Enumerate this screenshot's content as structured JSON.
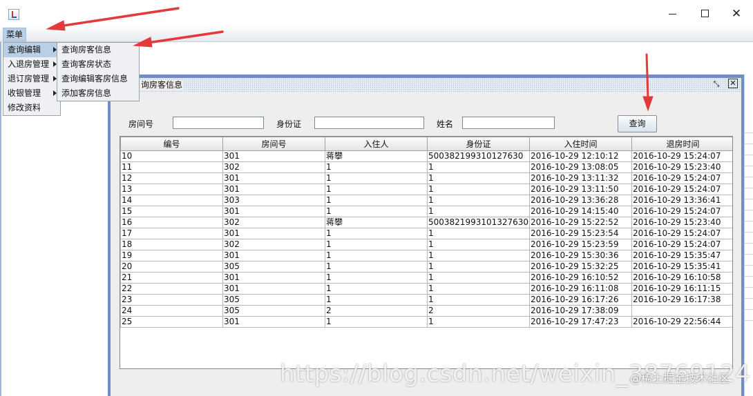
{
  "menubar": {
    "menu_label": "菜单"
  },
  "menu": {
    "items": [
      {
        "label": "查询编辑",
        "has_submenu": true
      },
      {
        "label": "入退房管理",
        "has_submenu": true
      },
      {
        "label": "退订房管理",
        "has_submenu": true
      },
      {
        "label": "收银管理",
        "has_submenu": true
      },
      {
        "label": "修改资料",
        "has_submenu": false
      }
    ],
    "submenu": [
      {
        "label": "查询房客信息"
      },
      {
        "label": "查询客房状态"
      },
      {
        "label": "查询编辑客房信息"
      },
      {
        "label": "添加客房信息"
      }
    ]
  },
  "window": {
    "title": "询房客信息",
    "colors": {
      "accent": "#b8cfe5",
      "frame": "#6f8fc3",
      "arrow": "#e23a3a"
    }
  },
  "search": {
    "room_label": "房间号",
    "room_value": "",
    "id_label": "身份证",
    "id_value": "",
    "name_label": "姓名",
    "name_value": "",
    "query_button": "查询"
  },
  "table": {
    "columns": [
      "编号",
      "房间号",
      "入住人",
      "身份证",
      "入住时间",
      "退房时间"
    ],
    "rows": [
      [
        "10",
        "301",
        "蒋攀",
        "500382199310127630",
        "2016-10-29 12:10:12",
        "2016-10-29 15:24:07"
      ],
      [
        "11",
        "302",
        "1",
        "1",
        "2016-10-29 13:08:05",
        "2016-10-29 15:23:40"
      ],
      [
        "12",
        "301",
        "1",
        "1",
        "2016-10-29 13:11:32",
        "2016-10-29 15:24:07"
      ],
      [
        "13",
        "301",
        "1",
        "1",
        "2016-10-29 13:11:50",
        "2016-10-29 15:24:07"
      ],
      [
        "14",
        "303",
        "1",
        "1",
        "2016-10-29 13:36:28",
        "2016-10-29 13:36:41"
      ],
      [
        "15",
        "301",
        "1",
        "1",
        "2016-10-29 14:15:40",
        "2016-10-29 15:24:07"
      ],
      [
        "16",
        "302",
        "蒋攀",
        "500382199310132763​0",
        "2016-10-29 15:22:52",
        "2016-10-29 15:23:40"
      ],
      [
        "17",
        "301",
        "1",
        "1",
        "2016-10-29 15:23:54",
        "2016-10-29 15:24:07"
      ],
      [
        "18",
        "302",
        "1",
        "1",
        "2016-10-29 15:23:59",
        "2016-10-29 15:24:07"
      ],
      [
        "19",
        "301",
        "1",
        "1",
        "2016-10-29 15:30:36",
        "2016-10-29 15:35:47"
      ],
      [
        "20",
        "305",
        "1",
        "1",
        "2016-10-29 15:32:25",
        "2016-10-29 15:35:41"
      ],
      [
        "21",
        "301",
        "1",
        "1",
        "2016-10-29 16:10:52",
        "2016-10-29 16:10:58"
      ],
      [
        "22",
        "301",
        "1",
        "1",
        "2016-10-29 16:11:08",
        "2016-10-29 16:11:15"
      ],
      [
        "23",
        "305",
        "1",
        "1",
        "2016-10-29 16:17:26",
        "2016-10-29 16:17:38"
      ],
      [
        "24",
        "305",
        "2",
        "2",
        "2016-10-29 17:38:09",
        ""
      ],
      [
        "25",
        "301",
        "1",
        "1",
        "2016-10-29 17:47:23",
        "2016-10-29 22:56:44"
      ]
    ]
  },
  "watermark": {
    "url": "https://blog.csdn.net/weixin_38769124",
    "site": "@稀土掘金技术社区"
  }
}
